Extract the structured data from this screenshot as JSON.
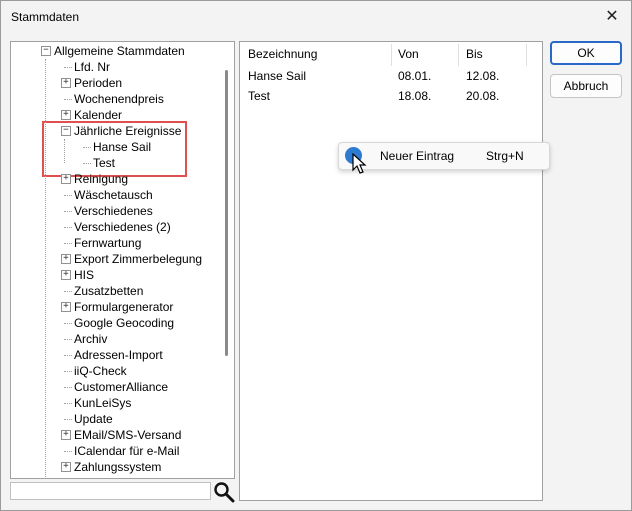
{
  "window": {
    "title": "Stammdaten",
    "close_glyph": "✕"
  },
  "tree": {
    "root": "Allgemeine Stammdaten",
    "items": [
      {
        "label": "Lfd. Nr",
        "expandable": false
      },
      {
        "label": "Perioden",
        "expandable": true
      },
      {
        "label": "Wochenendpreis",
        "expandable": false
      },
      {
        "label": "Kalender",
        "expandable": true
      },
      {
        "label": "Jährliche Ereignisse",
        "expandable": true,
        "expanded": true,
        "children": [
          "Hanse Sail",
          "Test"
        ]
      },
      {
        "label": "Reinigung",
        "expandable": true
      },
      {
        "label": "Wäschetausch",
        "expandable": false
      },
      {
        "label": "Verschiedenes",
        "expandable": false
      },
      {
        "label": "Verschiedenes (2)",
        "expandable": false
      },
      {
        "label": "Fernwartung",
        "expandable": false
      },
      {
        "label": "Export Zimmerbelegung",
        "expandable": true
      },
      {
        "label": "HIS",
        "expandable": true
      },
      {
        "label": "Zusatzbetten",
        "expandable": false
      },
      {
        "label": "Formulargenerator",
        "expandable": true
      },
      {
        "label": "Google Geocoding",
        "expandable": false
      },
      {
        "label": "Archiv",
        "expandable": false
      },
      {
        "label": "Adressen-Import",
        "expandable": false
      },
      {
        "label": "iiQ-Check",
        "expandable": false
      },
      {
        "label": "CustomerAlliance",
        "expandable": false
      },
      {
        "label": "KunLeiSys",
        "expandable": false
      },
      {
        "label": "Update",
        "expandable": false
      },
      {
        "label": "EMail/SMS-Versand",
        "expandable": true
      },
      {
        "label": "ICalendar für e-Mail",
        "expandable": false
      },
      {
        "label": "Zahlungssystem",
        "expandable": true
      }
    ]
  },
  "search": {
    "value": "",
    "icon": "search-icon"
  },
  "list": {
    "columns": [
      "Bezeichnung",
      "Von",
      "Bis"
    ],
    "rows": [
      [
        "Hanse Sail",
        "08.01.",
        "12.08."
      ],
      [
        "Test",
        "18.08.",
        "20.08."
      ]
    ]
  },
  "buttons": {
    "ok": "OK",
    "cancel": "Abbruch"
  },
  "context_menu": {
    "label": "Neuer Eintrag",
    "shortcut": "Strg+N"
  },
  "colors": {
    "highlight": "#e05050",
    "accent": "#2a68c8",
    "menu_icon": "#2d7bd0"
  }
}
